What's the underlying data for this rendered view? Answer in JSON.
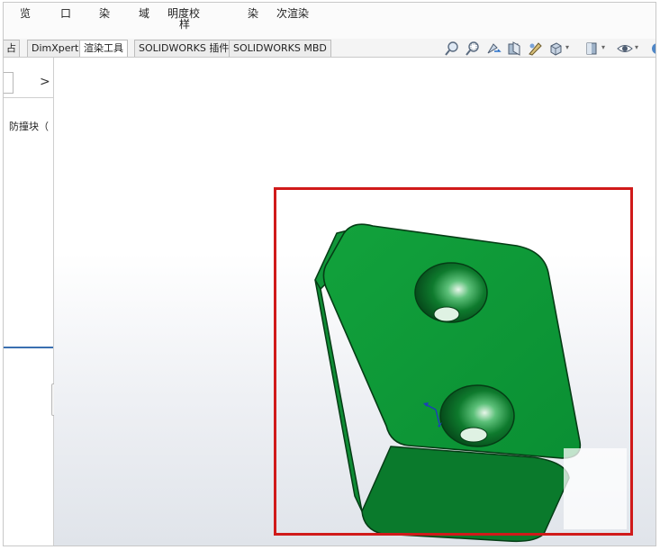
{
  "ribbon": {
    "items": [
      "览",
      "口",
      "染",
      "域",
      "明度校",
      "样",
      "染",
      "次渲染"
    ]
  },
  "command_tabs": [
    "占",
    "DimXpert",
    "渲染工具",
    "SOLIDWORKS 插件",
    "SOLIDWORKS MBD"
  ],
  "left_panel": {
    "arrow": ">",
    "feature_item": "防撞块（"
  },
  "heads_up_icons": [
    "zoom-to-fit-icon",
    "zoom-area-icon",
    "previous-view-icon",
    "section-view-icon",
    "dynamic-annotation-icon",
    "view-orientation-icon",
    "display-style-icon",
    "hide-show-items-icon"
  ],
  "colors": {
    "part_green": "#0a9a36",
    "highlight_red": "#d01a1a"
  }
}
